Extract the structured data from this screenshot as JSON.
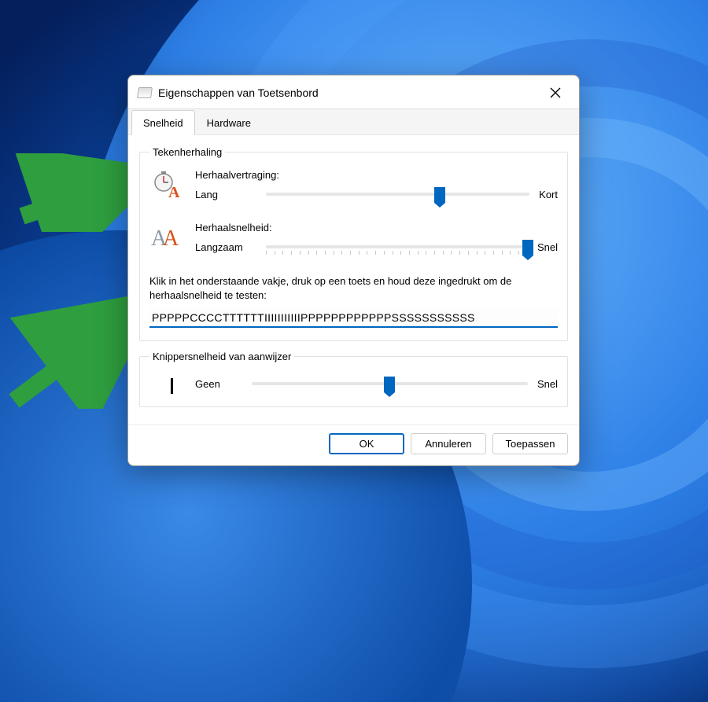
{
  "window": {
    "title": "Eigenschappen van Toetsenbord",
    "icon": "keyboard-icon"
  },
  "tabs": [
    {
      "label": "Snelheid",
      "active": true
    },
    {
      "label": "Hardware",
      "active": false
    }
  ],
  "groups": {
    "repeat": {
      "legend": "Tekenherhaling",
      "delay": {
        "label": "Herhaalvertraging:",
        "min_label": "Lang",
        "max_label": "Kort",
        "steps": 4,
        "value_index": 2,
        "value_percent": 66
      },
      "rate": {
        "label": "Herhaalsnelheid:",
        "min_label": "Langzaam",
        "max_label": "Snel",
        "steps": 32,
        "value_index": 31,
        "value_percent": 100
      },
      "test_hint": "Klik in het onderstaande vakje, druk op een toets en houd deze ingedrukt om de herhaalsnelheid te testen:",
      "test_value": "PPPPPCCCCTTTTTTIIIIIIIIIIIPPPPPPPPPPPPSSSSSSSSSSS"
    },
    "blink": {
      "legend": "Knippersnelheid van aanwijzer",
      "min_label": "Geen",
      "max_label": "Snel",
      "steps": 12,
      "value_index": 6,
      "value_percent": 50
    }
  },
  "buttons": {
    "ok": "OK",
    "cancel": "Annuleren",
    "apply": "Toepassen"
  },
  "colors": {
    "accent": "#0067c0",
    "annotation_arrow": "#2e9e3f"
  }
}
